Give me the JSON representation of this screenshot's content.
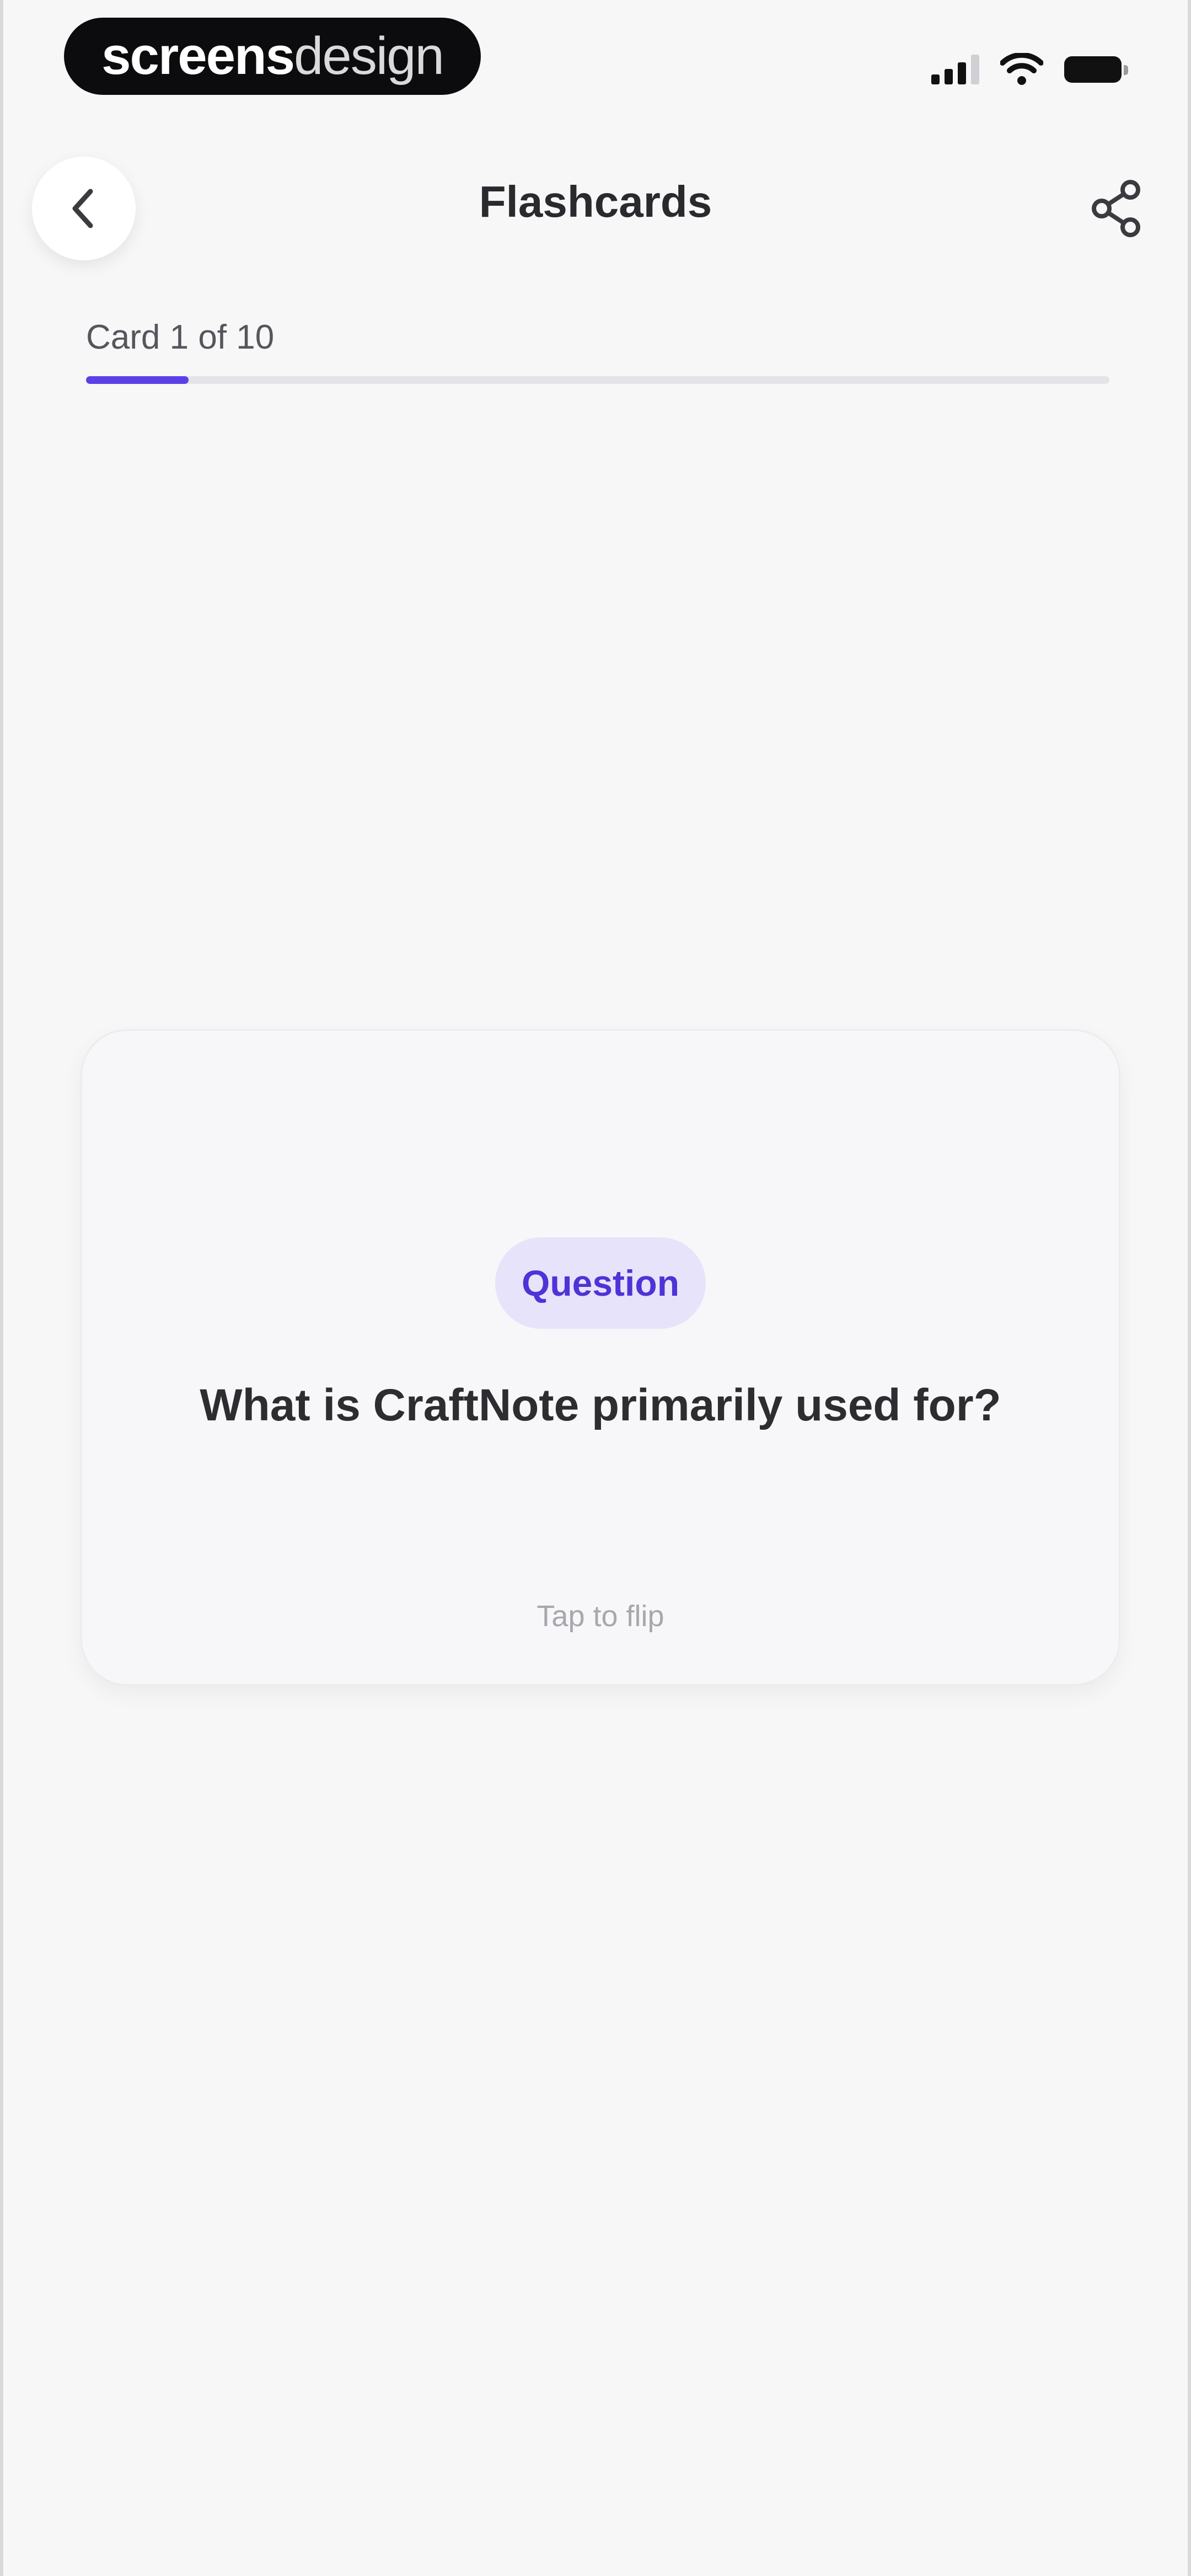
{
  "status_bar": {
    "brand_strong": "screens",
    "brand_light": "design"
  },
  "header": {
    "title": "Flashcards",
    "back_icon": "chevron-left-icon",
    "share_icon": "share-icon"
  },
  "progress": {
    "label": "Card 1 of 10",
    "fraction": 0.1,
    "accent_color": "#5b3fe8"
  },
  "card": {
    "tag": "Question",
    "text": "What is CraftNote primarily used for?",
    "hint": "Tap to flip"
  }
}
